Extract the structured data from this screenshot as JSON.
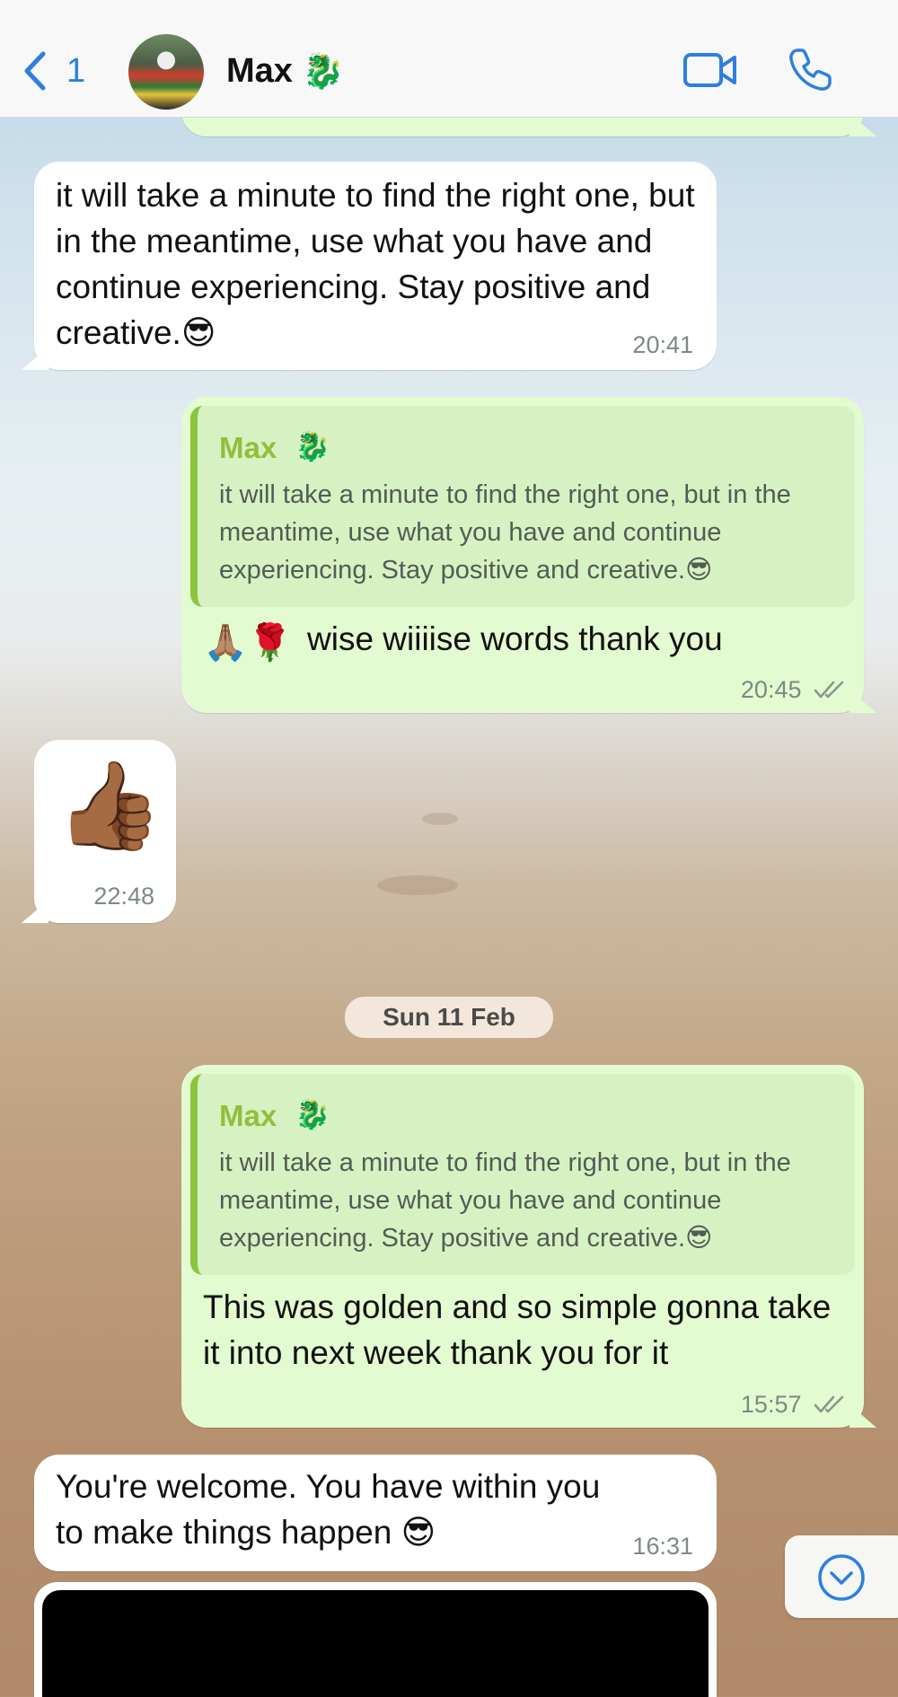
{
  "header": {
    "back_count": "1",
    "contact_name": "Max",
    "contact_emoji": "🐉",
    "icons": {
      "back": "chevron-left-icon",
      "video": "video-camera-icon",
      "call": "phone-icon"
    },
    "accent_color": "#2d7fe0"
  },
  "messages": [
    {
      "direction": "incoming",
      "text": "it will take a minute to find the right one, but in the meantime, use what you have and continue experiencing. Stay positive and creative.😎",
      "time": "20:41"
    },
    {
      "direction": "outgoing",
      "quote": {
        "name": "Max",
        "name_emoji": "🐉",
        "text": "it will take a minute to find the right one, but in the meantime, use what you have and continue experiencing. Stay positive and creative.😎"
      },
      "emoji": "🙏🏽🌹",
      "text": "wise wiiiise words thank you",
      "time": "20:45",
      "status": "read"
    },
    {
      "direction": "incoming",
      "emoji": "👍🏾",
      "time": "22:48"
    },
    {
      "direction": "outgoing",
      "quote": {
        "name": "Max",
        "name_emoji": "🐉",
        "text": "it will take a minute to find the right one, but in the meantime, use what you have and continue experiencing. Stay positive and creative.😎"
      },
      "text": "This was golden and so simple gonna take it into next week thank you for it",
      "time": "15:57",
      "status": "read"
    },
    {
      "direction": "incoming",
      "text": "You're welcome. You have within you to make things happen 😎",
      "time": "16:31"
    }
  ],
  "date_separator": "Sun 11 Feb",
  "scroll_button": {
    "icon": "chevron-down-circle-icon"
  },
  "colors": {
    "incoming": "#ffffff",
    "outgoing": "#e3fbd0",
    "quote_bar": "#8cc43f",
    "quote_name": "#8fbf3c"
  }
}
